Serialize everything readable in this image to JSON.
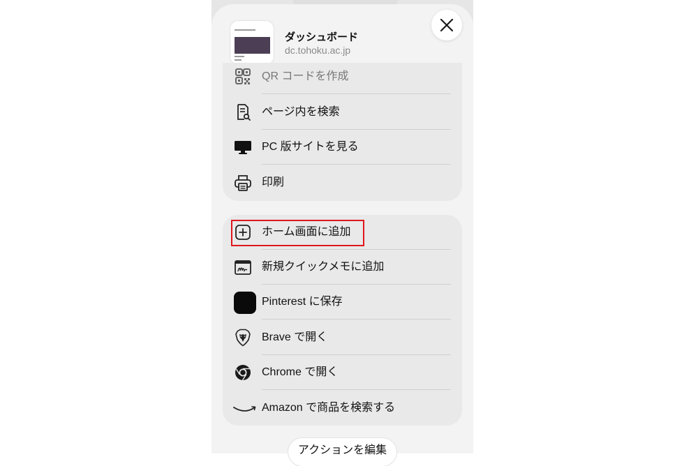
{
  "header": {
    "page_title": "ダッシュボード",
    "page_url": "dc.tohoku.ac.jp",
    "close_label": "×"
  },
  "group1": [
    {
      "label": "QR コードを作成",
      "icon": "qr-code-icon"
    },
    {
      "label": "ページ内を検索",
      "icon": "find-in-page-icon"
    },
    {
      "label": "PC 版サイトを見る",
      "icon": "desktop-icon"
    },
    {
      "label": "印刷",
      "icon": "printer-icon"
    }
  ],
  "group2": [
    {
      "label": "ホーム画面に追加",
      "icon": "add-square-icon",
      "highlighted": true
    },
    {
      "label": "新規クイックメモに追加",
      "icon": "quick-note-icon"
    },
    {
      "label": "Pinterest に保存",
      "icon": "pinterest-icon"
    },
    {
      "label": "Brave で開く",
      "icon": "brave-lion-icon"
    },
    {
      "label": "Chrome で開く",
      "icon": "chrome-icon"
    },
    {
      "label": "Amazon で商品を検索する",
      "icon": "amazon-smile-icon"
    }
  ],
  "footer": {
    "edit_actions_label": "アクションを編集"
  },
  "colors": {
    "highlight": "#e0161e",
    "group_bg": "#e9e9e9",
    "sheet_bg": "#f3f3f3"
  }
}
